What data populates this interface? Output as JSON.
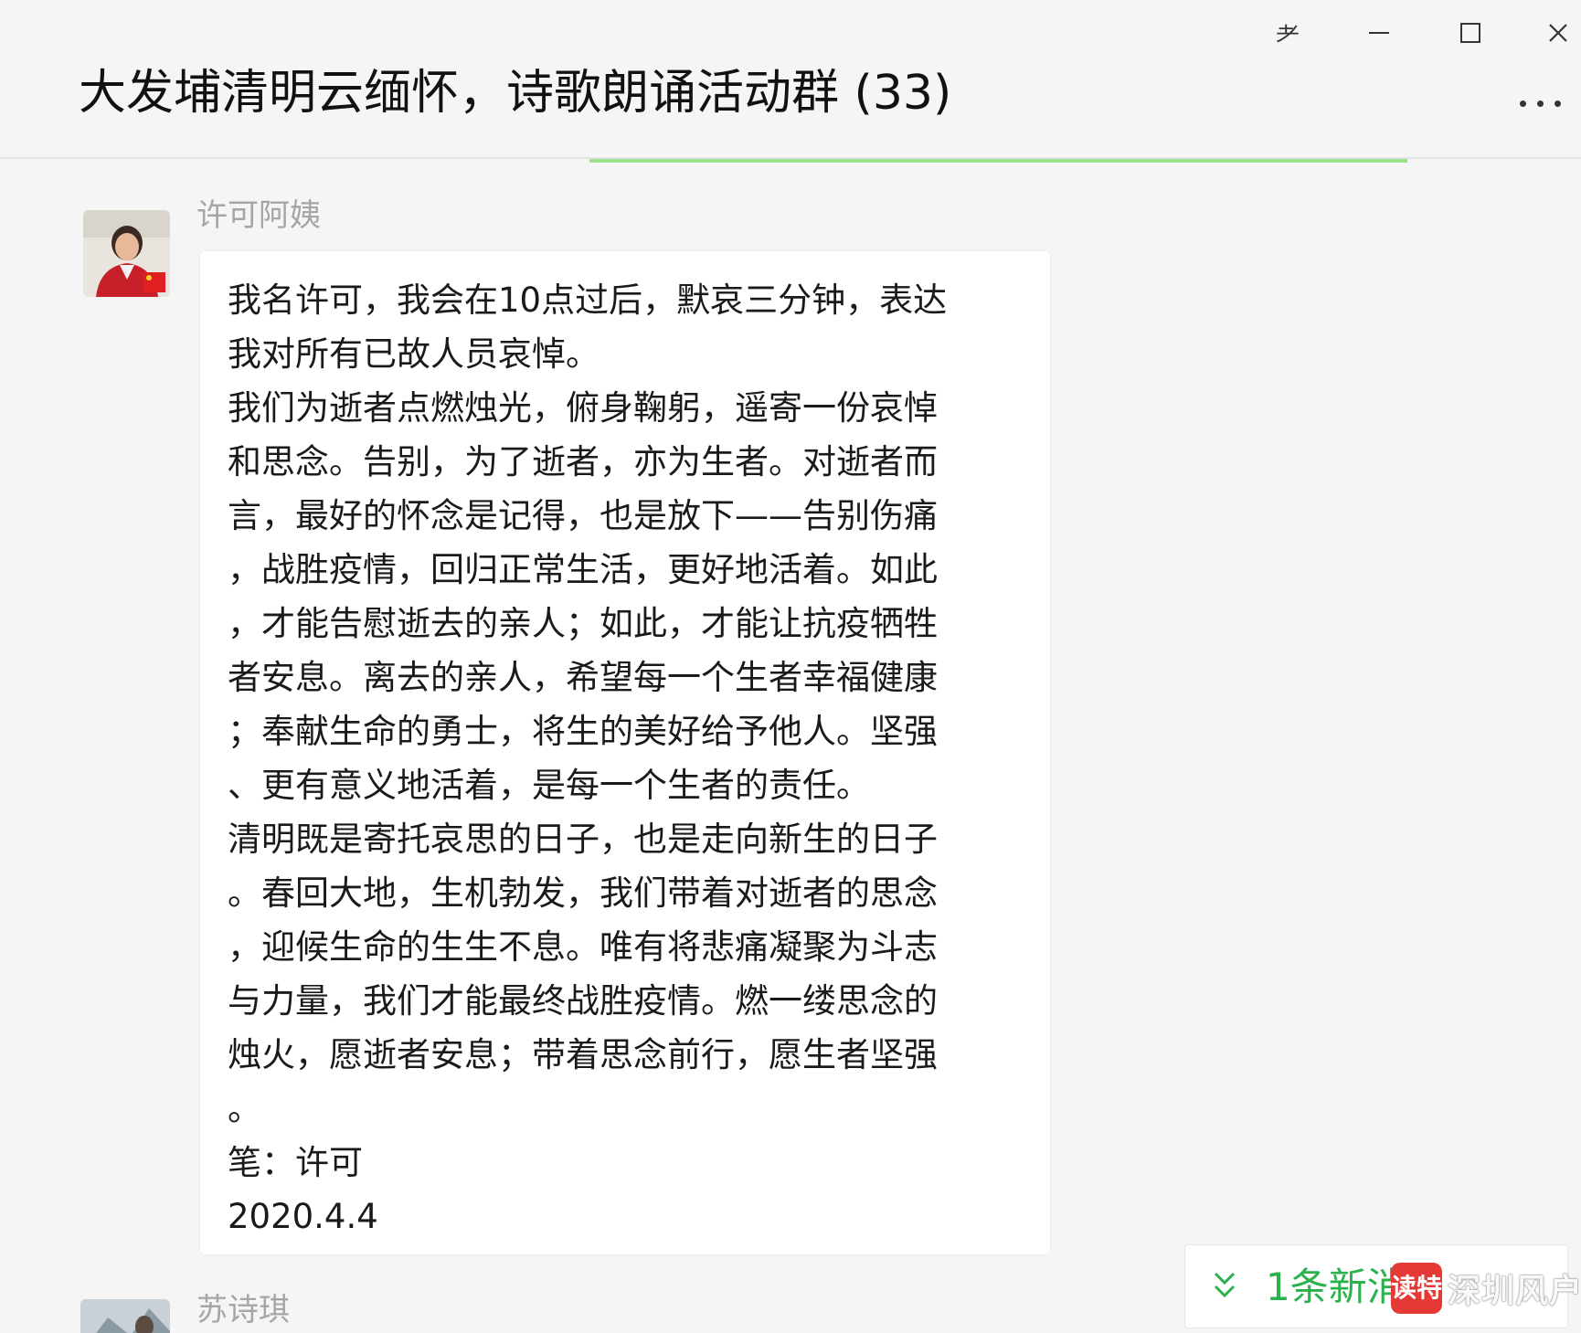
{
  "window": {
    "pin_glyph": "⺹",
    "minimize_glyph": "—",
    "maximize_glyph": "☐",
    "close_glyph": "✕"
  },
  "chat": {
    "title": "大发埔清明云缅怀，诗歌朗诵活动群 (33)",
    "more_icon": "more-dots-icon"
  },
  "messages": [
    {
      "sender": "许可阿姨",
      "lines": [
        "我名许可，我会在10点过后，默哀三分钟，表达",
        "我对所有已故人员哀悼。",
        "我们为逝者点燃烛光，俯身鞠躬，遥寄一份哀悼",
        "和思念。告别，为了逝者，亦为生者。对逝者而",
        "言，最好的怀念是记得，也是放下——告别伤痛",
        "，战胜疫情，回归正常生活，更好地活着。如此",
        "，才能告慰逝去的亲人；如此，才能让抗疫牺牲",
        "者安息。离去的亲人，希望每一个生者幸福健康",
        "；奉献生命的勇士，将生的美好给予他人。坚强",
        "、更有意义地活着，是每一个生者的责任。",
        "清明既是寄托哀思的日子，也是走向新生的日子",
        "。春回大地，生机勃发，我们带着对逝者的思念",
        "，迎候生命的生生不息。唯有将悲痛凝聚为斗志",
        "与力量，我们才能最终战胜疫情。燃一缕思念的",
        "烛火，愿逝者安息；带着思念前行，愿生者坚强",
        "。",
        "笔：许可",
        "2020.4.4"
      ]
    },
    {
      "sender": "苏诗琪"
    }
  ],
  "new_message_pill": {
    "text": "1条新消",
    "icon": "double-chevron-down-icon"
  },
  "watermark": {
    "badge": "读特",
    "text": "深圳风户"
  },
  "colors": {
    "accent_green": "#2bb24c",
    "progress_green": "#9be389",
    "watermark_red": "#e53935"
  }
}
